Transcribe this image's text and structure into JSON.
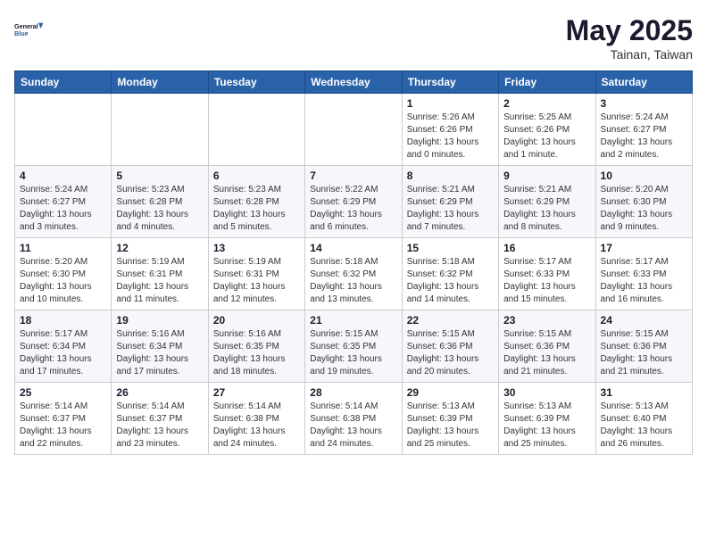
{
  "logo": {
    "line1": "General",
    "line2": "Blue"
  },
  "title": {
    "month_year": "May 2025",
    "location": "Tainan, Taiwan"
  },
  "headers": [
    "Sunday",
    "Monday",
    "Tuesday",
    "Wednesday",
    "Thursday",
    "Friday",
    "Saturday"
  ],
  "weeks": [
    [
      {
        "day": "",
        "info": ""
      },
      {
        "day": "",
        "info": ""
      },
      {
        "day": "",
        "info": ""
      },
      {
        "day": "",
        "info": ""
      },
      {
        "day": "1",
        "info": "Sunrise: 5:26 AM\nSunset: 6:26 PM\nDaylight: 13 hours\nand 0 minutes."
      },
      {
        "day": "2",
        "info": "Sunrise: 5:25 AM\nSunset: 6:26 PM\nDaylight: 13 hours\nand 1 minute."
      },
      {
        "day": "3",
        "info": "Sunrise: 5:24 AM\nSunset: 6:27 PM\nDaylight: 13 hours\nand 2 minutes."
      }
    ],
    [
      {
        "day": "4",
        "info": "Sunrise: 5:24 AM\nSunset: 6:27 PM\nDaylight: 13 hours\nand 3 minutes."
      },
      {
        "day": "5",
        "info": "Sunrise: 5:23 AM\nSunset: 6:28 PM\nDaylight: 13 hours\nand 4 minutes."
      },
      {
        "day": "6",
        "info": "Sunrise: 5:23 AM\nSunset: 6:28 PM\nDaylight: 13 hours\nand 5 minutes."
      },
      {
        "day": "7",
        "info": "Sunrise: 5:22 AM\nSunset: 6:29 PM\nDaylight: 13 hours\nand 6 minutes."
      },
      {
        "day": "8",
        "info": "Sunrise: 5:21 AM\nSunset: 6:29 PM\nDaylight: 13 hours\nand 7 minutes."
      },
      {
        "day": "9",
        "info": "Sunrise: 5:21 AM\nSunset: 6:29 PM\nDaylight: 13 hours\nand 8 minutes."
      },
      {
        "day": "10",
        "info": "Sunrise: 5:20 AM\nSunset: 6:30 PM\nDaylight: 13 hours\nand 9 minutes."
      }
    ],
    [
      {
        "day": "11",
        "info": "Sunrise: 5:20 AM\nSunset: 6:30 PM\nDaylight: 13 hours\nand 10 minutes."
      },
      {
        "day": "12",
        "info": "Sunrise: 5:19 AM\nSunset: 6:31 PM\nDaylight: 13 hours\nand 11 minutes."
      },
      {
        "day": "13",
        "info": "Sunrise: 5:19 AM\nSunset: 6:31 PM\nDaylight: 13 hours\nand 12 minutes."
      },
      {
        "day": "14",
        "info": "Sunrise: 5:18 AM\nSunset: 6:32 PM\nDaylight: 13 hours\nand 13 minutes."
      },
      {
        "day": "15",
        "info": "Sunrise: 5:18 AM\nSunset: 6:32 PM\nDaylight: 13 hours\nand 14 minutes."
      },
      {
        "day": "16",
        "info": "Sunrise: 5:17 AM\nSunset: 6:33 PM\nDaylight: 13 hours\nand 15 minutes."
      },
      {
        "day": "17",
        "info": "Sunrise: 5:17 AM\nSunset: 6:33 PM\nDaylight: 13 hours\nand 16 minutes."
      }
    ],
    [
      {
        "day": "18",
        "info": "Sunrise: 5:17 AM\nSunset: 6:34 PM\nDaylight: 13 hours\nand 17 minutes."
      },
      {
        "day": "19",
        "info": "Sunrise: 5:16 AM\nSunset: 6:34 PM\nDaylight: 13 hours\nand 17 minutes."
      },
      {
        "day": "20",
        "info": "Sunrise: 5:16 AM\nSunset: 6:35 PM\nDaylight: 13 hours\nand 18 minutes."
      },
      {
        "day": "21",
        "info": "Sunrise: 5:15 AM\nSunset: 6:35 PM\nDaylight: 13 hours\nand 19 minutes."
      },
      {
        "day": "22",
        "info": "Sunrise: 5:15 AM\nSunset: 6:36 PM\nDaylight: 13 hours\nand 20 minutes."
      },
      {
        "day": "23",
        "info": "Sunrise: 5:15 AM\nSunset: 6:36 PM\nDaylight: 13 hours\nand 21 minutes."
      },
      {
        "day": "24",
        "info": "Sunrise: 5:15 AM\nSunset: 6:36 PM\nDaylight: 13 hours\nand 21 minutes."
      }
    ],
    [
      {
        "day": "25",
        "info": "Sunrise: 5:14 AM\nSunset: 6:37 PM\nDaylight: 13 hours\nand 22 minutes."
      },
      {
        "day": "26",
        "info": "Sunrise: 5:14 AM\nSunset: 6:37 PM\nDaylight: 13 hours\nand 23 minutes."
      },
      {
        "day": "27",
        "info": "Sunrise: 5:14 AM\nSunset: 6:38 PM\nDaylight: 13 hours\nand 24 minutes."
      },
      {
        "day": "28",
        "info": "Sunrise: 5:14 AM\nSunset: 6:38 PM\nDaylight: 13 hours\nand 24 minutes."
      },
      {
        "day": "29",
        "info": "Sunrise: 5:13 AM\nSunset: 6:39 PM\nDaylight: 13 hours\nand 25 minutes."
      },
      {
        "day": "30",
        "info": "Sunrise: 5:13 AM\nSunset: 6:39 PM\nDaylight: 13 hours\nand 25 minutes."
      },
      {
        "day": "31",
        "info": "Sunrise: 5:13 AM\nSunset: 6:40 PM\nDaylight: 13 hours\nand 26 minutes."
      }
    ]
  ]
}
